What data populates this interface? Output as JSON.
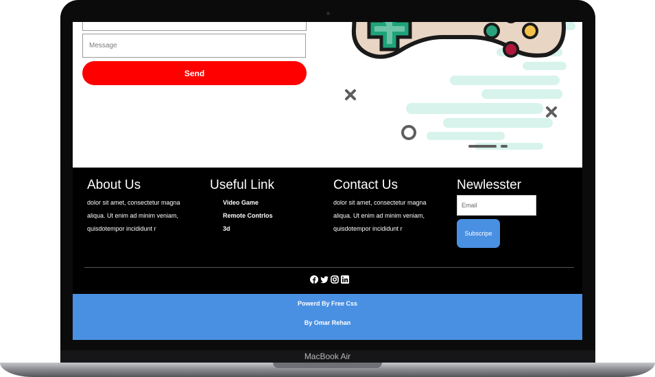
{
  "device": {
    "brand_label": "MacBook Air"
  },
  "contact_form": {
    "message_placeholder": "Message",
    "send_label": "Send"
  },
  "footer": {
    "about": {
      "title": "About Us",
      "text": "dolor sit amet, consectetur magna aliqua. Ut enim ad minim veniam, quisdotempor incididunt r"
    },
    "useful": {
      "title": "Useful Link",
      "links": [
        "Video Game",
        "Remote Contrlos",
        "3d"
      ]
    },
    "contact": {
      "title": "Contact Us",
      "text": "dolor sit amet, consectetur magna aliqua. Ut enim ad minim veniam, quisdotempor incididunt r"
    },
    "newsletter": {
      "title": "Newlesster",
      "email_placeholder": "Email",
      "subscribe_label": "Subscripe"
    },
    "social_icons": [
      "facebook-icon",
      "twitter-icon",
      "instagram-icon",
      "linkedin-icon"
    ]
  },
  "bottom_bar": {
    "line1": "Powerd By Free Css",
    "line2": "By Omar Rehan"
  },
  "colors": {
    "send_button": "#ff0000",
    "accent_blue": "#4a90e2",
    "footer_bg": "#000000"
  }
}
